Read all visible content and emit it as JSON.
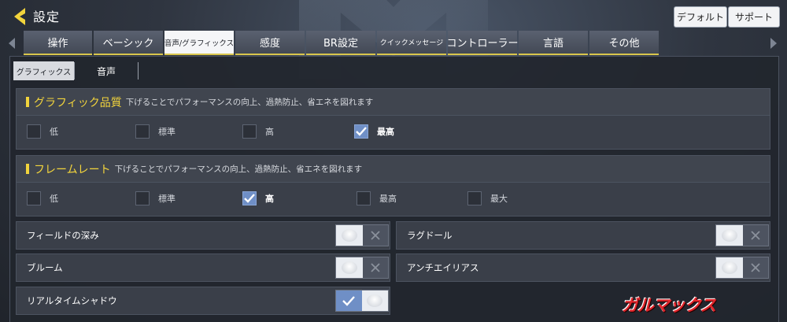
{
  "header": {
    "title": "設定",
    "default_button": "デフォルト",
    "support_button": "サポート"
  },
  "tabs": [
    {
      "label": "操作"
    },
    {
      "label": "ベーシック"
    },
    {
      "label": "音声/グラフィックス"
    },
    {
      "label": "感度"
    },
    {
      "label": "BR設定"
    },
    {
      "label": "クイックメッセージ"
    },
    {
      "label": "コントローラー"
    },
    {
      "label": "言語"
    },
    {
      "label": "その他"
    }
  ],
  "active_tab": "音声/グラフィックス",
  "subtabs": {
    "graphics": "グラフィックス",
    "sound": "音声"
  },
  "graphics_quality": {
    "title": "グラフィック品質",
    "description": "下げることでパフォーマンスの向上、過熱防止、省エネを図れます",
    "options": [
      "低",
      "標準",
      "高",
      "最高"
    ],
    "selected": "最高"
  },
  "frame_rate": {
    "title": "フレームレート",
    "description": "下げることでパフォーマンスの向上、過熱防止、省エネを図れます",
    "options": [
      "低",
      "標準",
      "高",
      "最高",
      "最大"
    ],
    "selected": "高"
  },
  "toggles": {
    "depth_of_field": {
      "label": "フィールドの深み",
      "on": false
    },
    "ragdoll": {
      "label": "ラグドール",
      "on": false
    },
    "bloom": {
      "label": "ブルーム",
      "on": false
    },
    "anti_aliasing": {
      "label": "アンチエイリアス",
      "on": false
    },
    "realtime_shadow": {
      "label": "リアルタイムシャドウ",
      "on": true
    }
  },
  "watermark": "ガルマックス",
  "colors": {
    "accent_yellow": "#f2d43c",
    "checked_blue": "#6f8fc6",
    "watermark_red": "#e3262c"
  }
}
